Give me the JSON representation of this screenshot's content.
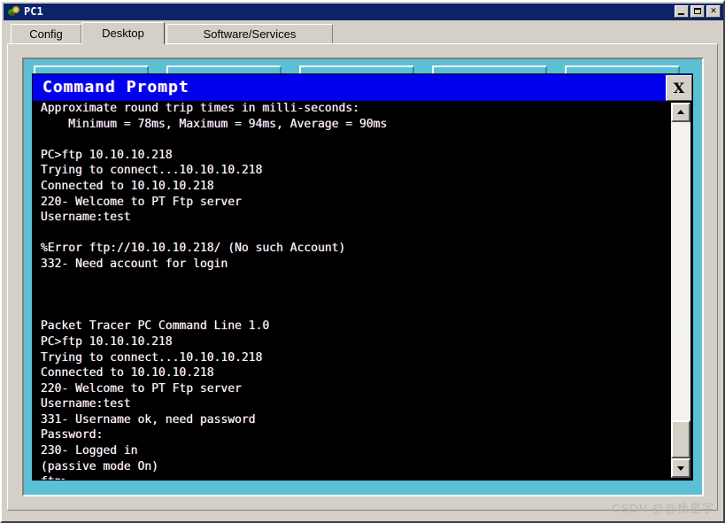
{
  "window": {
    "title": "PC1",
    "icon": "pc-device-icon",
    "buttons": [
      {
        "name": "minimize-button",
        "glyph": "_"
      },
      {
        "name": "maximize-button",
        "glyph": "□"
      },
      {
        "name": "close-button",
        "glyph": "✕"
      }
    ]
  },
  "tabs": [
    {
      "id": "config",
      "label": "Config",
      "active": false
    },
    {
      "id": "desktop",
      "label": "Desktop",
      "active": true
    },
    {
      "id": "software",
      "label": "Software/Services",
      "active": false
    }
  ],
  "desktop": {
    "background_color": "#5bc0d4",
    "icons": [
      {
        "name": "desktop-icon-1",
        "label": ""
      },
      {
        "name": "desktop-icon-2",
        "label": ""
      },
      {
        "name": "desktop-icon-3",
        "label": ""
      },
      {
        "name": "desktop-icon-4",
        "label": ""
      },
      {
        "name": "desktop-icon-5",
        "label": ""
      }
    ]
  },
  "command_prompt": {
    "title": "Command Prompt",
    "close_label": "X",
    "title_bar_color": "#0000ee",
    "background_color": "#000000",
    "text_color": "#ffffff",
    "lines": [
      "Approximate round trip times in milli-seconds:",
      "    Minimum = 78ms, Maximum = 94ms, Average = 90ms",
      "",
      "PC>ftp 10.10.10.218",
      "Trying to connect...10.10.10.218",
      "Connected to 10.10.10.218",
      "220- Welcome to PT Ftp server",
      "Username:test",
      "",
      "%Error ftp://10.10.10.218/ (No such Account)",
      "332- Need account for login",
      "",
      "",
      "",
      "Packet Tracer PC Command Line 1.0",
      "PC>ftp 10.10.10.218",
      "Trying to connect...10.10.10.218",
      "Connected to 10.10.10.218",
      "220- Welcome to PT Ftp server",
      "Username:test",
      "331- Username ok, need password",
      "Password:",
      "230- Logged in",
      "(passive mode On)",
      "ftp>"
    ],
    "scrollbar": {
      "up_arrow": "▲",
      "down_arrow": "▼",
      "thumb_position": "bottom"
    }
  },
  "watermark": "CSDN @@杨星宇"
}
